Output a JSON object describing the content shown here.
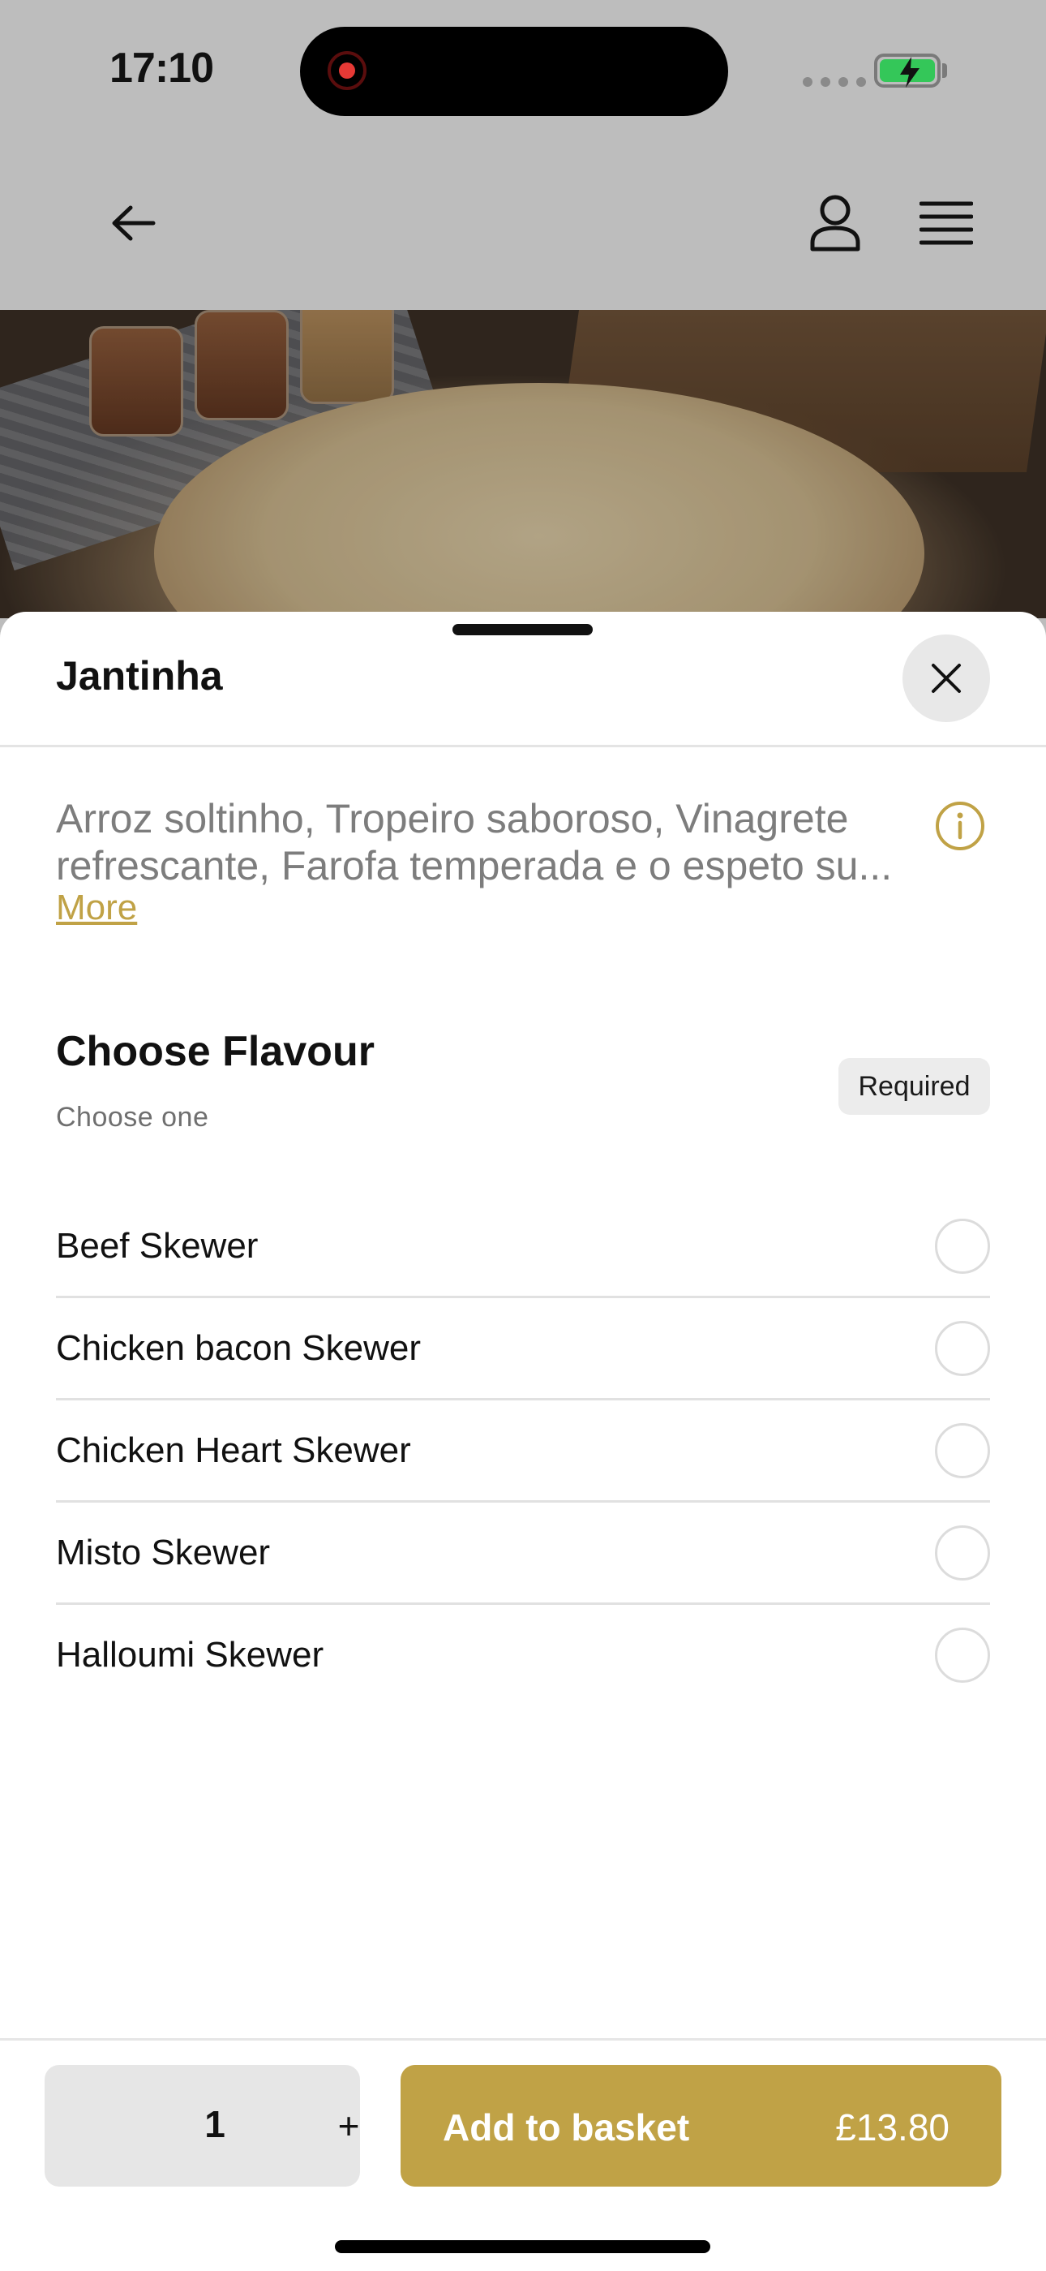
{
  "status_bar": {
    "time": "17:10"
  },
  "sheet": {
    "title": "Jantinha",
    "description": "Arroz soltinho, Tropeiro saboroso, Vinagrete refrescante, Farofa temperada e o espeto su...",
    "more_label": "More"
  },
  "flavour": {
    "title": "Choose Flavour",
    "subtitle": "Choose one",
    "badge": "Required",
    "options": [
      {
        "label": "Beef Skewer"
      },
      {
        "label": "Chicken bacon Skewer"
      },
      {
        "label": "Chicken Heart Skewer"
      },
      {
        "label": "Misto Skewer"
      },
      {
        "label": "Halloumi Skewer"
      }
    ]
  },
  "bottom": {
    "quantity": "1",
    "plus_label": "+",
    "add_label": "Add to basket",
    "price": "£13.80"
  },
  "colors": {
    "accent": "#c0a246",
    "overlay": "#bdbdbd"
  },
  "icons": [
    "back-arrow-icon",
    "user-icon",
    "menu-icon",
    "close-icon",
    "info-icon",
    "battery-icon",
    "record-icon"
  ]
}
